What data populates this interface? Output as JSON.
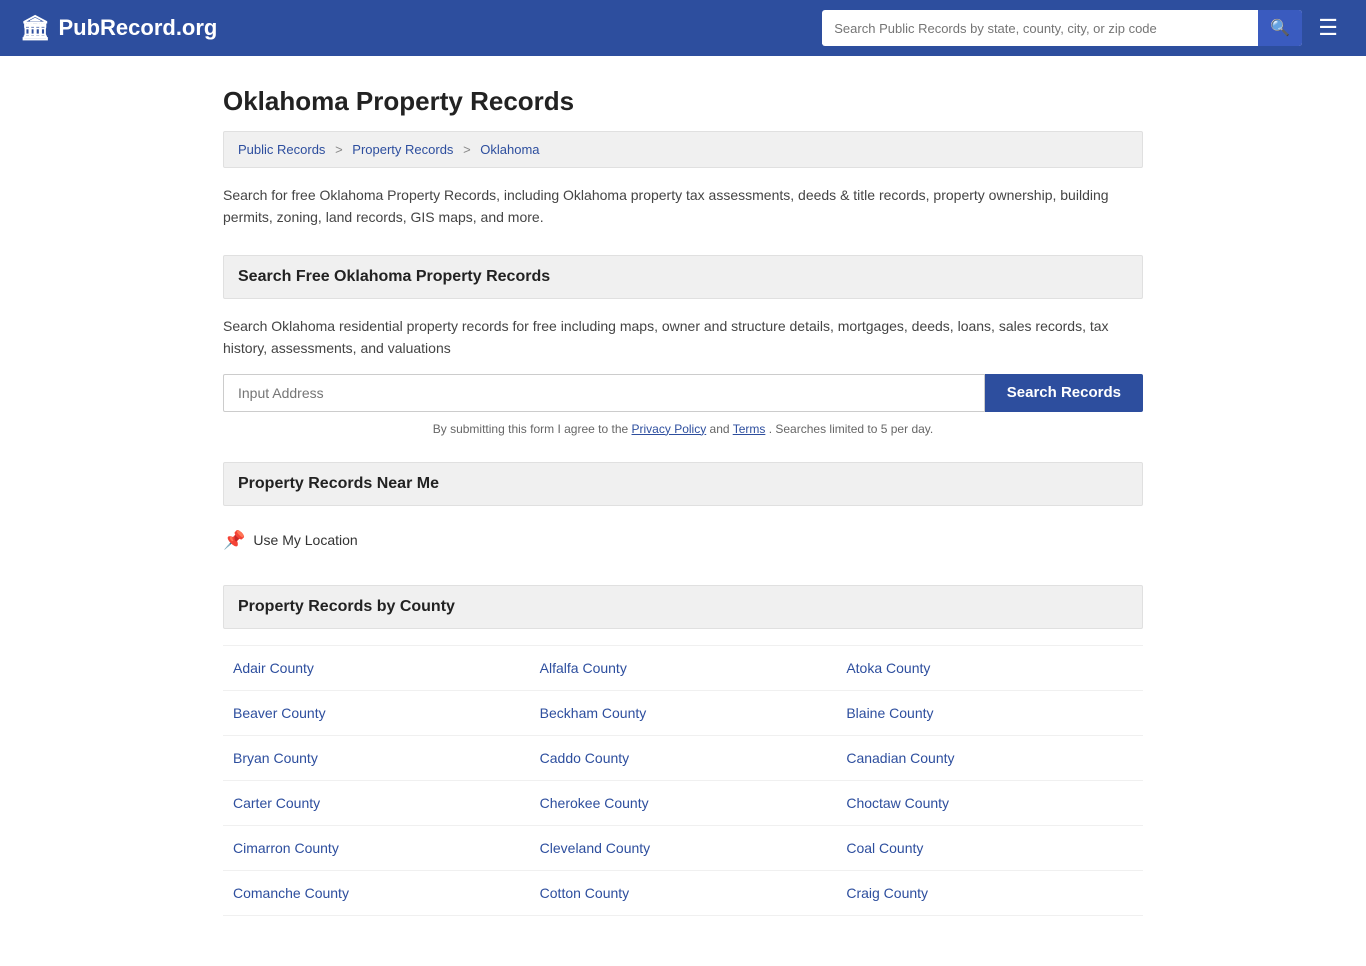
{
  "header": {
    "logo_text": "PubRecord.org",
    "search_placeholder": "Search Public Records by state, county, city, or zip code",
    "building_icon": "🏛"
  },
  "page": {
    "title": "Oklahoma Property Records",
    "breadcrumbs": [
      {
        "label": "Public Records",
        "href": "#"
      },
      {
        "label": "Property Records",
        "href": "#"
      },
      {
        "label": "Oklahoma",
        "href": "#"
      }
    ],
    "description": "Search for free Oklahoma Property Records, including Oklahoma property tax assessments, deeds & title records, property ownership, building permits, zoning, land records, GIS maps, and more.",
    "search_section": {
      "heading": "Search Free Oklahoma Property Records",
      "desc": "Search Oklahoma residential property records for free including maps, owner and structure details, mortgages, deeds, loans, sales records, tax history, assessments, and valuations",
      "input_placeholder": "Input Address",
      "button_label": "Search Records",
      "disclaimer": "By submitting this form I agree to the ",
      "privacy_policy_label": "Privacy Policy",
      "and_text": " and ",
      "terms_label": "Terms",
      "disclaimer_end": ". Searches limited to 5 per day."
    },
    "near_me_section": {
      "heading": "Property Records Near Me",
      "use_location_label": "Use My Location"
    },
    "county_section": {
      "heading": "Property Records by County",
      "counties": [
        "Adair County",
        "Alfalfa County",
        "Atoka County",
        "Beaver County",
        "Beckham County",
        "Blaine County",
        "Bryan County",
        "Caddo County",
        "Canadian County",
        "Carter County",
        "Cherokee County",
        "Choctaw County",
        "Cimarron County",
        "Cleveland County",
        "Coal County",
        "Comanche County",
        "Cotton County",
        "Craig County"
      ]
    }
  }
}
